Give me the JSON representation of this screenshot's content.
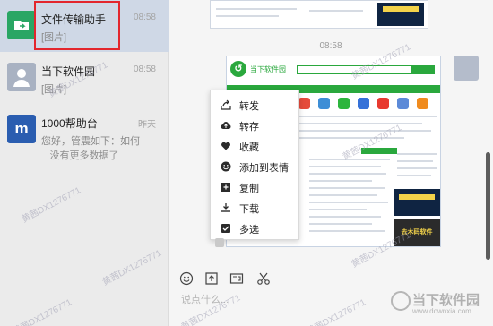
{
  "conversations": [
    {
      "name": "文件传输助手",
      "preview": "[图片]",
      "time": "08:58",
      "avatar_icon": "folder-icon"
    },
    {
      "name": "当下软件园",
      "preview": "[图片]",
      "time": "08:58",
      "avatar_icon": "user-icon"
    },
    {
      "name": "1000帮助台",
      "preview": "您好，管震如下：如何修改...",
      "time": "昨天",
      "avatar_icon": "mu-logo"
    }
  ],
  "no_more_text": "没有更多数据了",
  "watermark": "黄茜DX1276771",
  "chat": {
    "timestamp": "08:58",
    "screenshot_brand": "当下软件园",
    "screenshot_ad": "去木码软件"
  },
  "context_menu": [
    {
      "label": "转发",
      "icon": "forward-icon"
    },
    {
      "label": "转存",
      "icon": "cloud-upload-icon"
    },
    {
      "label": "收藏",
      "icon": "heart-icon"
    },
    {
      "label": "添加到表情",
      "icon": "emoji-icon"
    },
    {
      "label": "复制",
      "icon": "copy-icon"
    },
    {
      "label": "下载",
      "icon": "download-icon"
    },
    {
      "label": "多选",
      "icon": "checkbox-icon"
    }
  ],
  "input": {
    "placeholder": "说点什么...",
    "tools": [
      "emoji-icon",
      "upload-icon",
      "screenshot-icon",
      "scissors-icon"
    ]
  },
  "site_watermark": {
    "text": "当下软件园",
    "url": "www.downxia.com"
  },
  "colors": {
    "accent_green": "#2aa83d",
    "selection_red": "#e3262d",
    "selected_bg": "#cfd8e6"
  }
}
